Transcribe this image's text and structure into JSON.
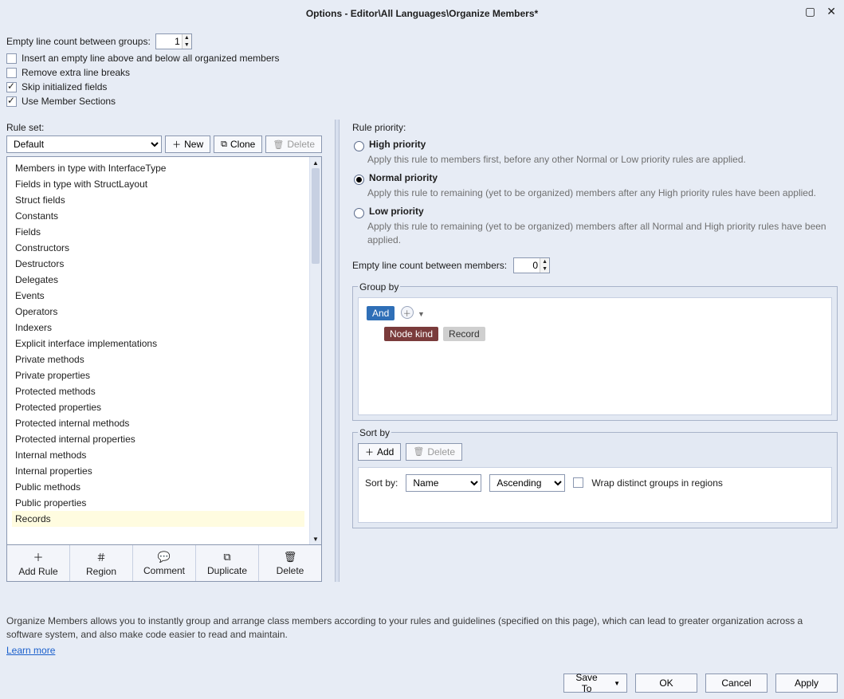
{
  "title": "Options - Editor\\All Languages\\Organize Members*",
  "top": {
    "lineCountLabel": "Empty line count between groups:",
    "lineCountValue": "1",
    "insertEmpty": {
      "label": "Insert an empty line above and below all organized members",
      "checked": false
    },
    "removeBreaks": {
      "label": "Remove extra line breaks",
      "checked": false
    },
    "skipInit": {
      "label": "Skip initialized fields",
      "checked": true
    },
    "useSections": {
      "label": "Use Member Sections",
      "checked": true
    }
  },
  "ruleset": {
    "label": "Rule set:",
    "selected": "Default",
    "buttons": {
      "new": "New",
      "clone": "Clone",
      "delete": "Delete"
    },
    "items": [
      "Members in type with InterfaceType",
      "Fields in type with StructLayout",
      "Struct fields",
      "Constants",
      "Fields",
      "Constructors",
      "Destructors",
      "Delegates",
      "Events",
      "Operators",
      "Indexers",
      "Explicit interface implementations",
      "Private methods",
      "Private properties",
      "Protected methods",
      "Protected properties",
      "Protected internal methods",
      "Protected internal properties",
      "Internal methods",
      "Internal properties",
      "Public methods",
      "Public properties",
      "Records"
    ],
    "selectedItemIndex": 22,
    "toolbar": [
      {
        "icon": "＋",
        "label": "Add Rule"
      },
      {
        "icon": "＃",
        "label": "Region"
      },
      {
        "icon": "💬",
        "label": "Comment"
      },
      {
        "icon": "⧉",
        "label": "Duplicate"
      },
      {
        "icon": "🗑",
        "label": "Delete"
      }
    ]
  },
  "priority": {
    "label": "Rule priority:",
    "options": [
      {
        "id": "high",
        "title": "High priority",
        "desc": "Apply this rule to members first, before any other Normal or Low priority rules are applied."
      },
      {
        "id": "normal",
        "title": "Normal priority",
        "desc": "Apply this rule to remaining (yet to be organized) members after any High priority rules have been applied."
      },
      {
        "id": "low",
        "title": "Low priority",
        "desc": "Apply this rule to remaining (yet to be organized) members after all Normal and High priority rules have been applied."
      }
    ],
    "selected": "normal",
    "membersLineLabel": "Empty line count between members:",
    "membersLineValue": "0"
  },
  "groupBy": {
    "legend": "Group by",
    "logic": "And",
    "chips": [
      {
        "text": "Node kind",
        "style": "dark"
      },
      {
        "text": "Record",
        "style": "grey"
      }
    ]
  },
  "sortBy": {
    "legend": "Sort by",
    "add": "Add",
    "delete": "Delete",
    "row": {
      "label": "Sort by:",
      "field": "Name",
      "direction": "Ascending",
      "wrapLabel": "Wrap distinct groups in regions",
      "wrapChecked": false
    }
  },
  "help": {
    "text": "Organize Members allows you to instantly group and arrange class members according to your rules and guidelines (specified on this page), which can lead to greater organization across a software system, and also make code easier to read and maintain.",
    "link": "Learn more"
  },
  "actions": {
    "saveTo": "Save To",
    "ok": "OK",
    "cancel": "Cancel",
    "apply": "Apply"
  }
}
